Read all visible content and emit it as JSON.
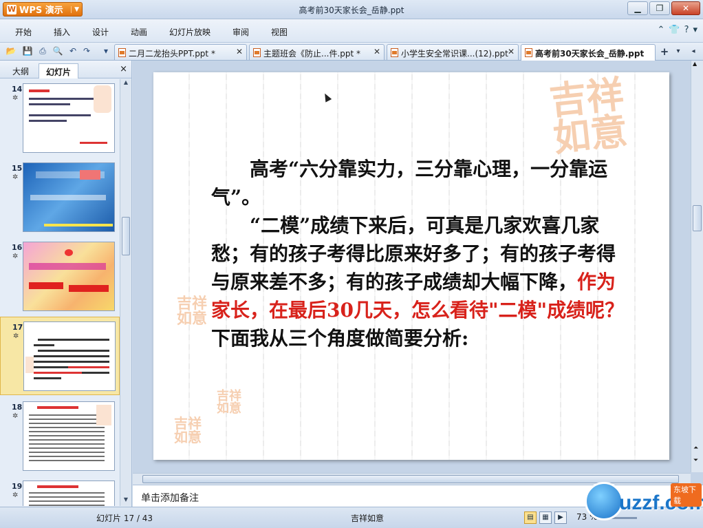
{
  "app": {
    "name": "WPS 演示",
    "window_title": "高考前30天家长会_岳静.ppt"
  },
  "menu": [
    "开始",
    "插入",
    "设计",
    "动画",
    "幻灯片放映",
    "审阅",
    "视图"
  ],
  "tabs": [
    {
      "label": "二月二龙抬头PPT.ppt *"
    },
    {
      "label": "主题班会《防止...件.ppt *"
    },
    {
      "label": "小学生安全常识课...(12).ppt"
    },
    {
      "label": "高考前30天家长会_岳静.ppt"
    }
  ],
  "left_panel": {
    "tab_outline": "大纲",
    "tab_slides": "幻灯片",
    "close": "×",
    "slide_numbers": [
      "14",
      "15",
      "16",
      "17",
      "18",
      "19"
    ],
    "selected": "17"
  },
  "slide": {
    "line1": "高考“六分靠实力，三分靠心理，一分靠运气”。",
    "line2_black": "“二模”成绩下来后，可真是几家欢喜几家愁；有的孩子考得比原来好多了；有的孩子考得与原来差不多；有的孩子成绩却大幅下降，",
    "line2_red": "作为家长，在最后30几天，怎么看待\"二模\"成绩呢？",
    "line2_end": "下面我从三个角度做简要分析:"
  },
  "notes_placeholder": "单击添加备注",
  "status": {
    "slide_indicator": "幻灯片 17 / 43",
    "theme": "吉祥如意",
    "zoom": "73 %"
  },
  "watermark": {
    "brand": "uzzf.com",
    "tag": "东坡下载"
  }
}
